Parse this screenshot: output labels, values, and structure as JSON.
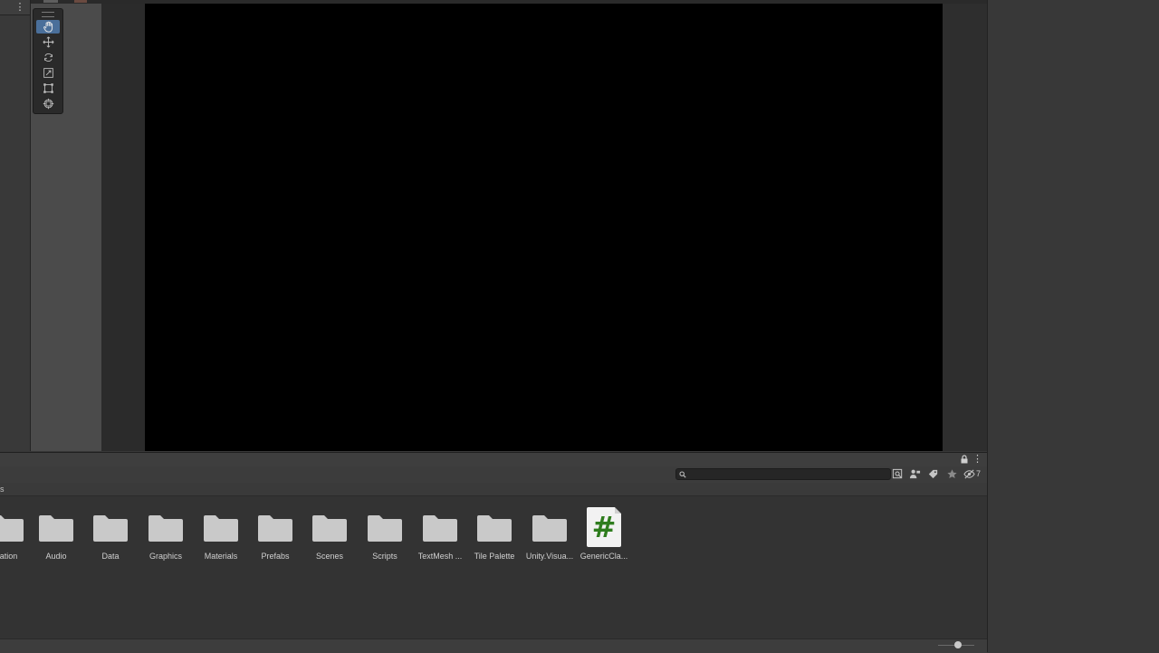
{
  "hierarchy": {
    "menu_glyph": "⋮"
  },
  "tools": {
    "items": [
      {
        "name": "hand-tool",
        "icon": "hand-icon",
        "active": true
      },
      {
        "name": "move-tool",
        "icon": "move-icon"
      },
      {
        "name": "rotate-tool",
        "icon": "rotate-icon"
      },
      {
        "name": "scale-tool",
        "icon": "scale-icon"
      },
      {
        "name": "rect-tool",
        "icon": "rect-icon"
      },
      {
        "name": "transform-tool",
        "icon": "transform-icon"
      }
    ],
    "active_color": "#4a6f9a"
  },
  "project": {
    "menu_glyph": "⋮",
    "search": {
      "value": "",
      "placeholder": ""
    },
    "hidden_count": "7",
    "breadcrumb": "s",
    "assets": [
      {
        "label": "nation",
        "type": "folder"
      },
      {
        "label": "Audio",
        "type": "folder"
      },
      {
        "label": "Data",
        "type": "folder"
      },
      {
        "label": "Graphics",
        "type": "folder"
      },
      {
        "label": "Materials",
        "type": "folder"
      },
      {
        "label": "Prefabs",
        "type": "folder"
      },
      {
        "label": "Scenes",
        "type": "folder"
      },
      {
        "label": "Scripts",
        "type": "folder"
      },
      {
        "label": "TextMesh ...",
        "type": "folder"
      },
      {
        "label": "Tile Palette",
        "type": "folder"
      },
      {
        "label": "Unity.Visua...",
        "type": "folder"
      },
      {
        "label": "GenericCla...",
        "type": "script",
        "glyph": "#"
      }
    ],
    "colors": {
      "folder": "#c9c9c9",
      "script_hash": "#2f7d1e"
    }
  }
}
